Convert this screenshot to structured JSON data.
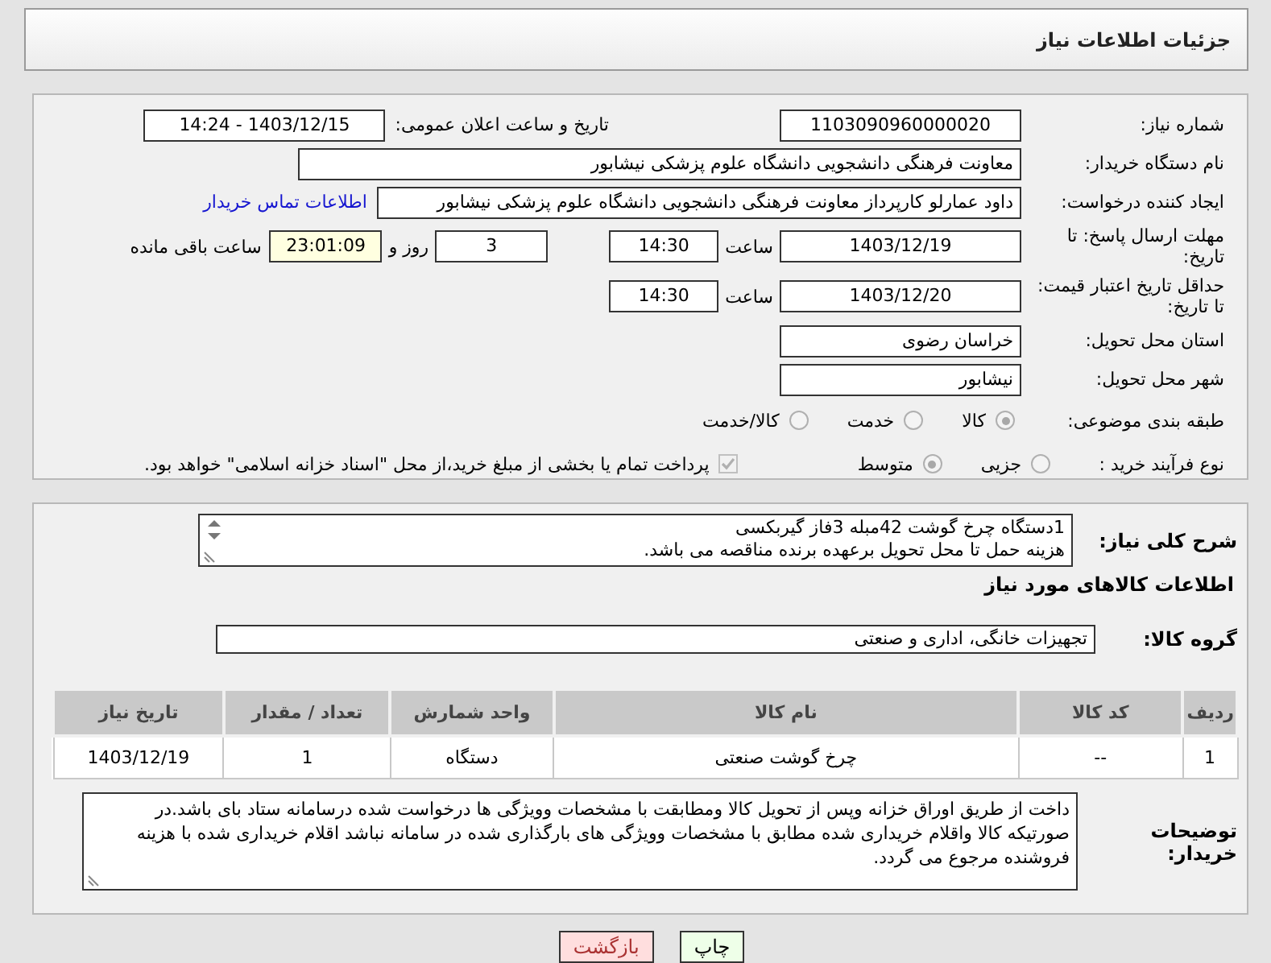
{
  "header": {
    "title": "جزئیات اطلاعات نیاز"
  },
  "need_number": {
    "label": "شماره نیاز:",
    "value": "1103090960000020"
  },
  "announce_datetime": {
    "label": "تاریخ و ساعت اعلان عمومی:",
    "value": "1403/12/15 - 14:24"
  },
  "buyer_org": {
    "label": "نام دستگاه خریدار:",
    "value": "معاونت فرهنگی دانشجویی دانشگاه علوم پزشکی نیشابور"
  },
  "requester": {
    "label": "ایجاد کننده درخواست:",
    "value": "داود عمارلو کارپرداز معاونت فرهنگی دانشجویی دانشگاه علوم پزشکی نیشابور",
    "link": "اطلاعات تماس خریدار"
  },
  "reply_deadline": {
    "label": "مهلت ارسال پاسخ: تا تاریخ:",
    "date": "1403/12/19",
    "time_label": "ساعت",
    "time": "14:30",
    "days": "3",
    "days_label": "روز و",
    "remaining": "23:01:09",
    "remaining_label": "ساعت باقی مانده"
  },
  "price_validity": {
    "label": "حداقل تاریخ اعتبار قیمت: تا تاریخ:",
    "date": "1403/12/20",
    "time_label": "ساعت",
    "time": "14:30"
  },
  "province": {
    "label": "استان محل تحویل:",
    "value": "خراسان رضوی"
  },
  "city": {
    "label": "شهر محل تحویل:",
    "value": "نیشابور"
  },
  "category": {
    "label": "طبقه بندی موضوعی:",
    "options": [
      {
        "label": "کالا",
        "selected": true
      },
      {
        "label": "خدمت",
        "selected": false
      },
      {
        "label": "کالا/خدمت",
        "selected": false
      }
    ]
  },
  "purchase_process": {
    "label": "نوع فرآیند خرید :",
    "options": [
      {
        "label": "جزیی",
        "selected": false
      },
      {
        "label": "متوسط",
        "selected": true
      }
    ],
    "treasury": {
      "label": "پرداخت تمام یا بخشی از مبلغ خرید،از محل \"اسناد خزانه اسلامی\" خواهد بود.",
      "checked": true
    }
  },
  "description": {
    "label": "شرح کلی نیاز:",
    "lines": [
      "1دستگاه چرخ گوشت 42مبله 3فاز گیربکسی",
      "هزینه حمل تا محل تحویل برعهده برنده مناقصه می باشد."
    ]
  },
  "items_section": {
    "title": "اطلاعات کالاهای مورد نیاز"
  },
  "goods_group": {
    "label": "گروه کالا:",
    "value": "تجهیزات خانگی، اداری و صنعتی"
  },
  "table": {
    "columns": [
      "ردیف",
      "کد کالا",
      "نام کالا",
      "واحد شمارش",
      "تعداد / مقدار",
      "تاریخ نیاز"
    ],
    "rows": [
      [
        "1",
        "--",
        "چرخ گوشت صنعتی",
        "دستگاه",
        "1",
        "1403/12/19"
      ]
    ]
  },
  "buyer_notes": {
    "label": "توضیحات خریدار:",
    "value": "داخت از طریق اوراق خزانه وپس از تحویل کالا ومطابقت با مشخصات  وویژگی ها درخواست شده درسامانه ستاد بای باشد.در صورتیکه کالا واقلام خریداری شده مطابق با مشخصات وویژگی های بارگذاری شده در سامانه نباشد اقلام خریداری شده با هزینه فروشنده مرجوع می گردد."
  },
  "buttons": [
    {
      "label": "چاپ",
      "kind": "print"
    },
    {
      "label": "بازگشت",
      "kind": "back"
    }
  ]
}
